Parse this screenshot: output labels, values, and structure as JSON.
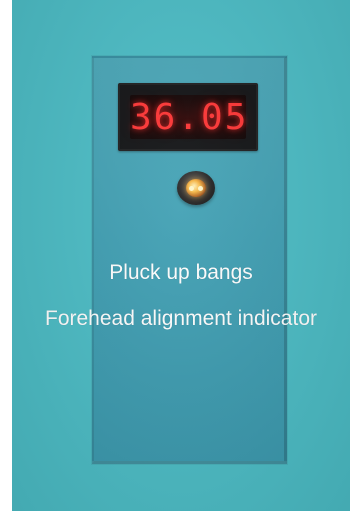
{
  "device": {
    "display_reading": "36.05",
    "display_color": "#ff3434",
    "panel_color": "#4aa7b8",
    "background_color": "#4bbdc6",
    "sensor_icon": "infrared-sensor-icon"
  },
  "captions": {
    "line1": "Pluck up bangs",
    "line2": "Forehead alignment indicator"
  }
}
